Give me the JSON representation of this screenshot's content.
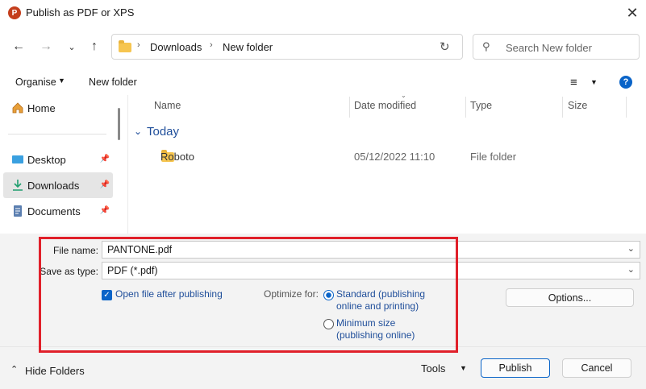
{
  "window": {
    "title": "Publish as PDF or XPS",
    "app_icon_letter": "P"
  },
  "nav": {
    "breadcrumb": [
      "Downloads",
      "New folder"
    ],
    "search_placeholder": "Search New folder"
  },
  "toolbar": {
    "organise": "Organise",
    "new_folder": "New folder",
    "help": "?"
  },
  "sidebar": {
    "items": [
      {
        "label": "Home",
        "icon": "home-icon"
      },
      {
        "label": "Desktop",
        "icon": "desktop-icon",
        "pinned": true
      },
      {
        "label": "Downloads",
        "icon": "download-icon",
        "pinned": true,
        "selected": true
      },
      {
        "label": "Documents",
        "icon": "document-icon",
        "pinned": true
      }
    ]
  },
  "list": {
    "columns": [
      "Name",
      "Date modified",
      "Type",
      "Size"
    ],
    "group": "Today",
    "rows": [
      {
        "name": "Roboto",
        "date": "05/12/2022 11:10",
        "type": "File folder",
        "size": ""
      }
    ]
  },
  "form": {
    "file_name_label": "File name:",
    "file_name_value": "PANTONE.pdf",
    "save_type_label": "Save as type:",
    "save_type_value": "PDF (*.pdf)",
    "open_after_label": "Open file after publishing",
    "open_after_checked": true,
    "optimize_label": "Optimize for:",
    "opt_standard_1": "Standard (publishing",
    "opt_standard_2": "online and printing)",
    "opt_min_1": "Minimum size",
    "opt_min_2": "(publishing online)",
    "optimize_selected": "standard",
    "options_button": "Options..."
  },
  "footer": {
    "hide_folders": "Hide Folders",
    "tools": "Tools",
    "publish": "Publish",
    "cancel": "Cancel"
  },
  "colors": {
    "accent": "#0a64c8",
    "highlight_box": "#e0202a"
  }
}
